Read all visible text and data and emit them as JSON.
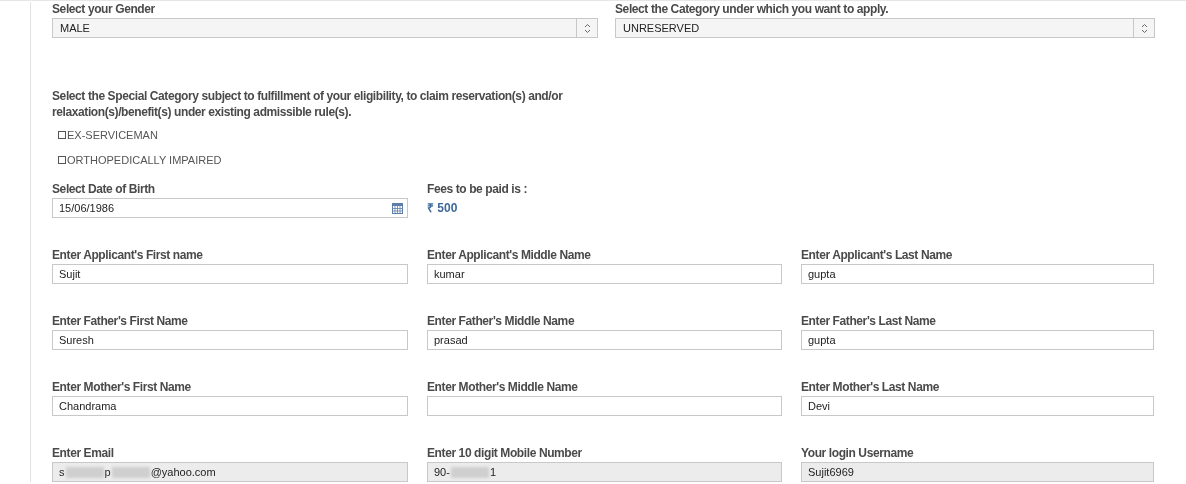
{
  "gender": {
    "label": "Select your Gender",
    "value": "MALE"
  },
  "category": {
    "label": "Select the Category under which you want to apply.",
    "value": "UNRESERVED"
  },
  "special_category": {
    "label": "Select the Special Category subject to fulfillment of your eligibility, to claim reservation(s) and/or relaxation(s)/benefit(s) under existing admissible rule(s).",
    "options": [
      {
        "label": "EX-SERVICEMAN",
        "checked": false
      },
      {
        "label": "ORTHOPEDICALLY IMPAIRED",
        "checked": false
      }
    ]
  },
  "date_of_birth": {
    "label": "Select Date of Birth",
    "value": "15/06/1986"
  },
  "fees": {
    "label": "Fees to be paid is :",
    "value": "₹ 500"
  },
  "rows": [
    [
      {
        "label": "Enter Applicant's First name",
        "value": "Sujit",
        "readonly": false
      },
      {
        "label": "Enter Applicant's Middle Name",
        "value": "kumar",
        "readonly": false
      },
      {
        "label": "Enter Applicant's Last Name",
        "value": "gupta",
        "readonly": false
      }
    ],
    [
      {
        "label": "Enter Father's First Name",
        "value": "Suresh",
        "readonly": false
      },
      {
        "label": "Enter Father's Middle Name",
        "value": "prasad",
        "readonly": false
      },
      {
        "label": "Enter Father's Last Name",
        "value": "gupta",
        "readonly": false
      }
    ],
    [
      {
        "label": "Enter Mother's First Name",
        "value": "Chandrama",
        "readonly": false
      },
      {
        "label": "Enter Mother's Middle Name",
        "readonly": false
      },
      {
        "label": "Enter Mother's Last Name",
        "value": "Devi",
        "readonly": false
      }
    ],
    [
      {
        "label": "Enter Email",
        "value_parts": [
          "s",
          "p",
          "@yahoo.com"
        ],
        "readonly": true
      },
      {
        "label": "Enter 10 digit Mobile Number",
        "value_parts": [
          "90-",
          "1"
        ],
        "readonly": true
      },
      {
        "label": "Your login Username",
        "value": "Sujit6969",
        "readonly": true
      }
    ]
  ]
}
